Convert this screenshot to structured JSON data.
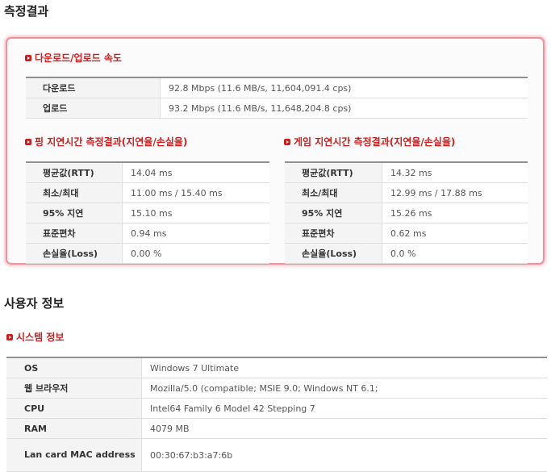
{
  "page_title": "측정결과",
  "speed": {
    "heading": "다운로드/업로드 속도",
    "rows": [
      {
        "label": "다운로드",
        "value": "92.8 Mbps (11.6 MB/s, 11,604,091.4 cps)"
      },
      {
        "label": "업로드",
        "value": "93.2 Mbps (11.6 MB/s, 11,648,204.8 cps)"
      }
    ]
  },
  "ping": {
    "heading": "핑 지연시간 측정결과(지연율/손실율)",
    "rows": [
      {
        "label": "평균값(RTT)",
        "value": "14.04 ms"
      },
      {
        "label": "최소/최대",
        "value": "11.00 ms / 15.40 ms"
      },
      {
        "label": "95% 지연",
        "value": "15.10 ms"
      },
      {
        "label": "표준편차",
        "value": "0.94 ms"
      },
      {
        "label": "손실율(Loss)",
        "value": "0.00 %"
      }
    ]
  },
  "game": {
    "heading": "게임 지연시간 측정결과(지연율/손실율)",
    "rows": [
      {
        "label": "평균값(RTT)",
        "value": "14.32 ms"
      },
      {
        "label": "최소/최대",
        "value": "12.99 ms / 17.88 ms"
      },
      {
        "label": "95% 지연",
        "value": "15.26 ms"
      },
      {
        "label": "표준편차",
        "value": "0.62 ms"
      },
      {
        "label": "손실율(Loss)",
        "value": "0.0 %"
      }
    ]
  },
  "user_title": "사용자 정보",
  "system": {
    "heading": "시스템 정보",
    "rows": [
      {
        "label": "OS",
        "value": "Windows 7 Ultimate"
      },
      {
        "label": "웹 브라우저",
        "value": "Mozilla/5.0 (compatible; MSIE 9.0; Windows NT 6.1;"
      },
      {
        "label": "CPU",
        "value": "Intel64 Family 6 Model 42 Stepping 7"
      },
      {
        "label": "RAM",
        "value": "4079 MB"
      },
      {
        "label": "Lan card MAC address",
        "value": "00:30:67:b3:a7:6b"
      }
    ]
  },
  "colors": {
    "accent": "#cc1f1f",
    "box_border": "#f0919b"
  },
  "icons": {
    "section_bullet": "red-square-arrow-icon"
  }
}
